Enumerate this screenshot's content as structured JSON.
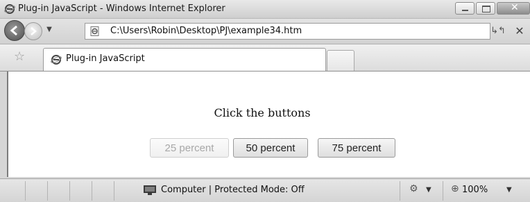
{
  "window": {
    "title": "Plug-in JavaScript - Windows Internet Explorer"
  },
  "address_bar": {
    "url": "C:\\Users\\Robin\\Desktop\\PJ\\example34.htm"
  },
  "tabs": [
    {
      "label": "Plug-in JavaScript"
    }
  ],
  "page": {
    "heading": "Click the buttons",
    "buttons": [
      {
        "label": "25 percent",
        "state": "disabled"
      },
      {
        "label": "50 percent",
        "state": "normal"
      },
      {
        "label": "75 percent",
        "state": "normal"
      }
    ]
  },
  "status_bar": {
    "zone_text": "Computer | Protected Mode: Off",
    "zoom": "100%"
  },
  "icons": {
    "title": "ie-logo-icon",
    "back": "back-arrow-icon",
    "forward": "forward-arrow-icon",
    "page": "page-ie-icon",
    "refresh": "refresh-icon",
    "stop": "close-icon",
    "favorites": "star-icon",
    "zone": "computer-icon",
    "security": "security-icon",
    "zoom": "magnifier-icon"
  }
}
